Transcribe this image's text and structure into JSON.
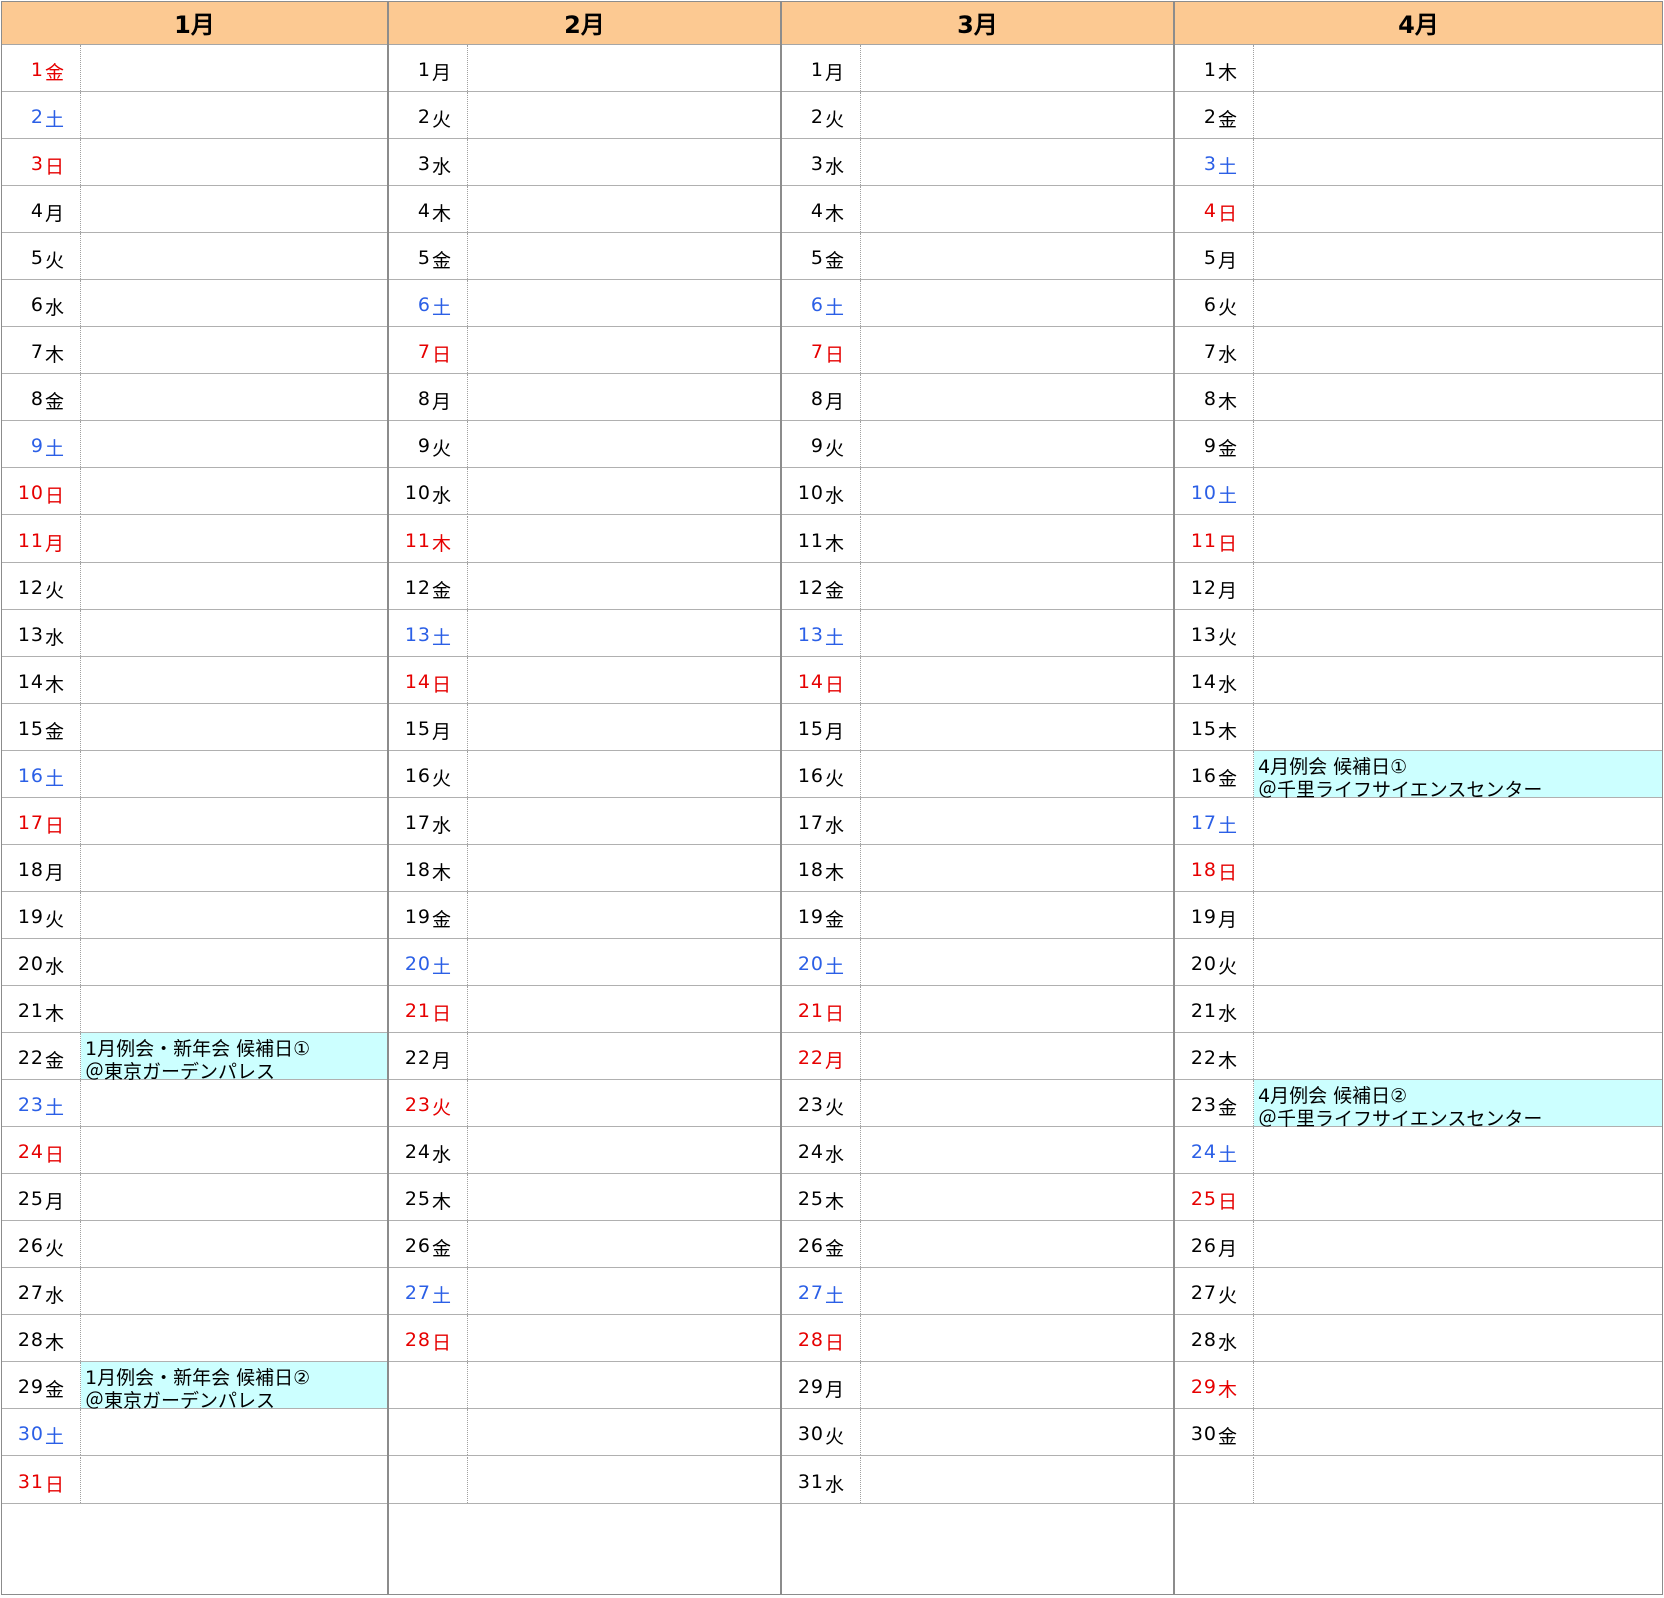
{
  "colors": {
    "header_bg": "#fcc992",
    "event_bg": "#ccffff",
    "saturday": "#2b5fe6",
    "holiday": "#e60000"
  },
  "months": [
    {
      "title": "1月",
      "days": [
        {
          "d": "1",
          "w": "金",
          "t": "hol"
        },
        {
          "d": "2",
          "w": "土",
          "t": "sat"
        },
        {
          "d": "3",
          "w": "日",
          "t": "hol"
        },
        {
          "d": "4",
          "w": "月",
          "t": ""
        },
        {
          "d": "5",
          "w": "火",
          "t": ""
        },
        {
          "d": "6",
          "w": "水",
          "t": ""
        },
        {
          "d": "7",
          "w": "木",
          "t": ""
        },
        {
          "d": "8",
          "w": "金",
          "t": ""
        },
        {
          "d": "9",
          "w": "土",
          "t": "sat"
        },
        {
          "d": "10",
          "w": "日",
          "t": "hol"
        },
        {
          "d": "11",
          "w": "月",
          "t": "hol"
        },
        {
          "d": "12",
          "w": "火",
          "t": ""
        },
        {
          "d": "13",
          "w": "水",
          "t": ""
        },
        {
          "d": "14",
          "w": "木",
          "t": ""
        },
        {
          "d": "15",
          "w": "金",
          "t": ""
        },
        {
          "d": "16",
          "w": "土",
          "t": "sat"
        },
        {
          "d": "17",
          "w": "日",
          "t": "hol"
        },
        {
          "d": "18",
          "w": "月",
          "t": ""
        },
        {
          "d": "19",
          "w": "火",
          "t": ""
        },
        {
          "d": "20",
          "w": "水",
          "t": ""
        },
        {
          "d": "21",
          "w": "木",
          "t": ""
        },
        {
          "d": "22",
          "w": "金",
          "t": "",
          "ev": [
            "1月例会・新年会 候補日①",
            "＠東京ガーデンパレス"
          ]
        },
        {
          "d": "23",
          "w": "土",
          "t": "sat"
        },
        {
          "d": "24",
          "w": "日",
          "t": "hol"
        },
        {
          "d": "25",
          "w": "月",
          "t": ""
        },
        {
          "d": "26",
          "w": "火",
          "t": ""
        },
        {
          "d": "27",
          "w": "水",
          "t": ""
        },
        {
          "d": "28",
          "w": "木",
          "t": ""
        },
        {
          "d": "29",
          "w": "金",
          "t": "",
          "ev": [
            "1月例会・新年会 候補日②",
            "＠東京ガーデンパレス"
          ]
        },
        {
          "d": "30",
          "w": "土",
          "t": "sat"
        },
        {
          "d": "31",
          "w": "日",
          "t": "hol"
        }
      ]
    },
    {
      "title": "2月",
      "days": [
        {
          "d": "1",
          "w": "月",
          "t": ""
        },
        {
          "d": "2",
          "w": "火",
          "t": ""
        },
        {
          "d": "3",
          "w": "水",
          "t": ""
        },
        {
          "d": "4",
          "w": "木",
          "t": ""
        },
        {
          "d": "5",
          "w": "金",
          "t": ""
        },
        {
          "d": "6",
          "w": "土",
          "t": "sat"
        },
        {
          "d": "7",
          "w": "日",
          "t": "hol"
        },
        {
          "d": "8",
          "w": "月",
          "t": ""
        },
        {
          "d": "9",
          "w": "火",
          "t": ""
        },
        {
          "d": "10",
          "w": "水",
          "t": ""
        },
        {
          "d": "11",
          "w": "木",
          "t": "hol"
        },
        {
          "d": "12",
          "w": "金",
          "t": ""
        },
        {
          "d": "13",
          "w": "土",
          "t": "sat"
        },
        {
          "d": "14",
          "w": "日",
          "t": "hol"
        },
        {
          "d": "15",
          "w": "月",
          "t": ""
        },
        {
          "d": "16",
          "w": "火",
          "t": ""
        },
        {
          "d": "17",
          "w": "水",
          "t": ""
        },
        {
          "d": "18",
          "w": "木",
          "t": ""
        },
        {
          "d": "19",
          "w": "金",
          "t": ""
        },
        {
          "d": "20",
          "w": "土",
          "t": "sat"
        },
        {
          "d": "21",
          "w": "日",
          "t": "hol"
        },
        {
          "d": "22",
          "w": "月",
          "t": ""
        },
        {
          "d": "23",
          "w": "火",
          "t": "hol"
        },
        {
          "d": "24",
          "w": "水",
          "t": ""
        },
        {
          "d": "25",
          "w": "木",
          "t": ""
        },
        {
          "d": "26",
          "w": "金",
          "t": ""
        },
        {
          "d": "27",
          "w": "土",
          "t": "sat"
        },
        {
          "d": "28",
          "w": "日",
          "t": "hol"
        }
      ]
    },
    {
      "title": "3月",
      "days": [
        {
          "d": "1",
          "w": "月",
          "t": ""
        },
        {
          "d": "2",
          "w": "火",
          "t": ""
        },
        {
          "d": "3",
          "w": "水",
          "t": ""
        },
        {
          "d": "4",
          "w": "木",
          "t": ""
        },
        {
          "d": "5",
          "w": "金",
          "t": ""
        },
        {
          "d": "6",
          "w": "土",
          "t": "sat"
        },
        {
          "d": "7",
          "w": "日",
          "t": "hol"
        },
        {
          "d": "8",
          "w": "月",
          "t": ""
        },
        {
          "d": "9",
          "w": "火",
          "t": ""
        },
        {
          "d": "10",
          "w": "水",
          "t": ""
        },
        {
          "d": "11",
          "w": "木",
          "t": ""
        },
        {
          "d": "12",
          "w": "金",
          "t": ""
        },
        {
          "d": "13",
          "w": "土",
          "t": "sat"
        },
        {
          "d": "14",
          "w": "日",
          "t": "hol"
        },
        {
          "d": "15",
          "w": "月",
          "t": ""
        },
        {
          "d": "16",
          "w": "火",
          "t": ""
        },
        {
          "d": "17",
          "w": "水",
          "t": ""
        },
        {
          "d": "18",
          "w": "木",
          "t": ""
        },
        {
          "d": "19",
          "w": "金",
          "t": ""
        },
        {
          "d": "20",
          "w": "土",
          "t": "sat"
        },
        {
          "d": "21",
          "w": "日",
          "t": "hol"
        },
        {
          "d": "22",
          "w": "月",
          "t": "hol"
        },
        {
          "d": "23",
          "w": "火",
          "t": ""
        },
        {
          "d": "24",
          "w": "水",
          "t": ""
        },
        {
          "d": "25",
          "w": "木",
          "t": ""
        },
        {
          "d": "26",
          "w": "金",
          "t": ""
        },
        {
          "d": "27",
          "w": "土",
          "t": "sat"
        },
        {
          "d": "28",
          "w": "日",
          "t": "hol"
        },
        {
          "d": "29",
          "w": "月",
          "t": ""
        },
        {
          "d": "30",
          "w": "火",
          "t": ""
        },
        {
          "d": "31",
          "w": "水",
          "t": ""
        }
      ]
    },
    {
      "title": "4月",
      "days": [
        {
          "d": "1",
          "w": "木",
          "t": ""
        },
        {
          "d": "2",
          "w": "金",
          "t": ""
        },
        {
          "d": "3",
          "w": "土",
          "t": "sat"
        },
        {
          "d": "4",
          "w": "日",
          "t": "hol"
        },
        {
          "d": "5",
          "w": "月",
          "t": ""
        },
        {
          "d": "6",
          "w": "火",
          "t": ""
        },
        {
          "d": "7",
          "w": "水",
          "t": ""
        },
        {
          "d": "8",
          "w": "木",
          "t": ""
        },
        {
          "d": "9",
          "w": "金",
          "t": ""
        },
        {
          "d": "10",
          "w": "土",
          "t": "sat"
        },
        {
          "d": "11",
          "w": "日",
          "t": "hol"
        },
        {
          "d": "12",
          "w": "月",
          "t": ""
        },
        {
          "d": "13",
          "w": "火",
          "t": ""
        },
        {
          "d": "14",
          "w": "水",
          "t": ""
        },
        {
          "d": "15",
          "w": "木",
          "t": ""
        },
        {
          "d": "16",
          "w": "金",
          "t": "",
          "ev": [
            "4月例会 候補日①",
            "＠千里ライフサイエンスセンター"
          ]
        },
        {
          "d": "17",
          "w": "土",
          "t": "sat"
        },
        {
          "d": "18",
          "w": "日",
          "t": "hol"
        },
        {
          "d": "19",
          "w": "月",
          "t": ""
        },
        {
          "d": "20",
          "w": "火",
          "t": ""
        },
        {
          "d": "21",
          "w": "水",
          "t": ""
        },
        {
          "d": "22",
          "w": "木",
          "t": ""
        },
        {
          "d": "23",
          "w": "金",
          "t": "",
          "ev": [
            "4月例会 候補日②",
            "＠千里ライフサイエンスセンター"
          ]
        },
        {
          "d": "24",
          "w": "土",
          "t": "sat"
        },
        {
          "d": "25",
          "w": "日",
          "t": "hol"
        },
        {
          "d": "26",
          "w": "月",
          "t": ""
        },
        {
          "d": "27",
          "w": "火",
          "t": ""
        },
        {
          "d": "28",
          "w": "水",
          "t": ""
        },
        {
          "d": "29",
          "w": "木",
          "t": "hol"
        },
        {
          "d": "30",
          "w": "金",
          "t": ""
        }
      ]
    }
  ]
}
